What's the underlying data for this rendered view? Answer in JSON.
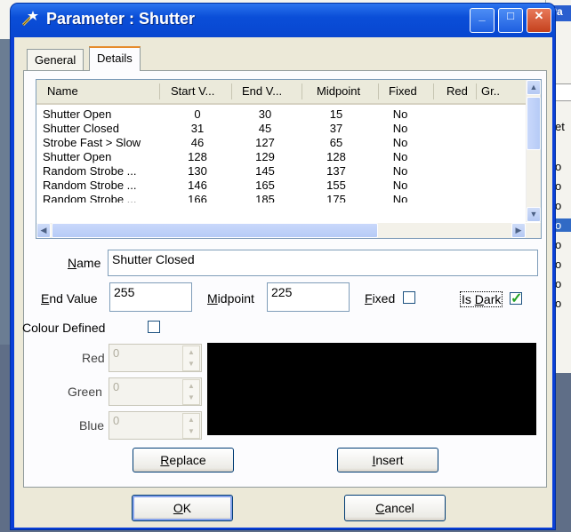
{
  "background": {
    "right_title": "Pa",
    "right_items": [
      "et",
      "o",
      "o",
      "o",
      "o",
      "o",
      "o",
      "o",
      "o"
    ]
  },
  "window": {
    "title": "Parameter : Shutter",
    "minimize_glyph": "_",
    "maximize_glyph": "□",
    "close_glyph": "✕"
  },
  "tabs": [
    {
      "label": "General",
      "active": false
    },
    {
      "label": "Details",
      "active": true
    }
  ],
  "list": {
    "columns": [
      "Name",
      "Start V...",
      "End V...",
      "Midpoint",
      "Fixed",
      "Red",
      "Gr.."
    ],
    "rows": [
      [
        "Shutter Open",
        "0",
        "30",
        "15",
        "No"
      ],
      [
        "Shutter Closed",
        "31",
        "45",
        "37",
        "No"
      ],
      [
        "Strobe Fast > Slow",
        "46",
        "127",
        "65",
        "No"
      ],
      [
        "Shutter Open",
        "128",
        "129",
        "128",
        "No"
      ],
      [
        "Random Strobe ...",
        "130",
        "145",
        "137",
        "No"
      ],
      [
        "Random Strobe ...",
        "146",
        "165",
        "155",
        "No"
      ],
      [
        "Random Strobe ...",
        "166",
        "185",
        "175",
        "No"
      ]
    ]
  },
  "form": {
    "name_label": "Name",
    "name_value": "Shutter Closed",
    "end_value_label": "End Value",
    "end_value": "255",
    "midpoint_label": "Midpoint",
    "midpoint_value": "225",
    "fixed_label": "Fixed",
    "fixed_checked": false,
    "is_dark_label": "Is Dark",
    "is_dark_checked": true,
    "colour_defined_label": "Colour Defined",
    "colour_defined_checked": false,
    "red_label": "Red",
    "red_value": "0",
    "green_label": "Green",
    "green_value": "0",
    "blue_label": "Blue",
    "blue_value": "0",
    "swatch_color": "#000000"
  },
  "buttons": {
    "replace": "Replace",
    "insert": "Insert",
    "ok": "OK",
    "cancel": "Cancel"
  },
  "colors": {
    "titlebar": "#0a4ed8",
    "dialog_bg": "#ece9d8",
    "selection": "#316ac5"
  }
}
